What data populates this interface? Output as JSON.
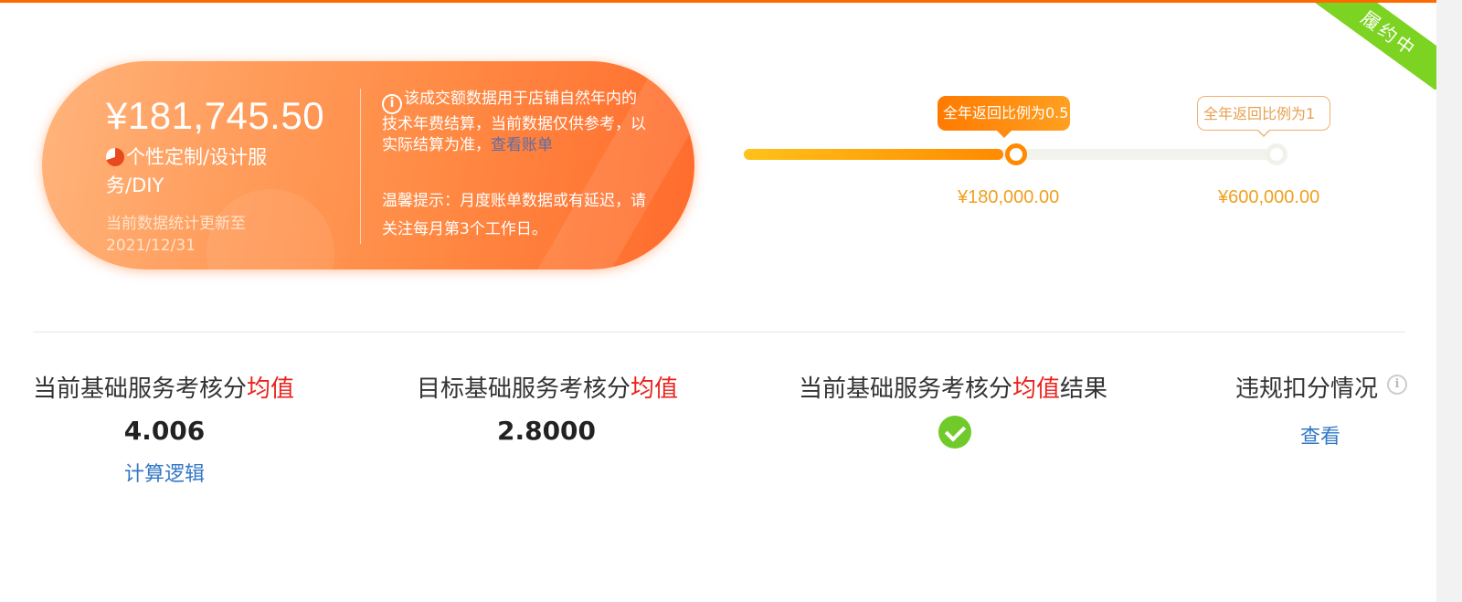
{
  "status_ribbon": {
    "label": "履约中",
    "color": "#7cd321"
  },
  "summary": {
    "amount": "¥181,745.50",
    "category": "个性定制/设计服务/DIY",
    "update_label": "当前数据统计更新至2021/12/31",
    "notice_text": "该成交额数据用于店铺自然年内的技术年费结算，当前数据仅供参考，以实际结算为准，",
    "view_bill_link": "查看账单",
    "warm_tip": "温馨提示：月度账单数据或有延迟，请关注每月第3个工作日。",
    "accent_color": "#ff7a30"
  },
  "progress": {
    "fill_fraction": 0.49,
    "tiers": [
      {
        "label": "全年返回比例为0.5",
        "amount": "¥180,000.00",
        "active": true
      },
      {
        "label": "全年返回比例为1",
        "amount": "¥600,000.00",
        "active": false
      }
    ]
  },
  "stats": [
    {
      "label_prefix": "当前基础服务考核分",
      "label_highlight": "均值",
      "label_suffix": "",
      "value": "4.006",
      "link": "计算逻辑"
    },
    {
      "label_prefix": "目标基础服务考核分",
      "label_highlight": "均值",
      "label_suffix": "",
      "value": "2.8000"
    },
    {
      "label_prefix": "当前基础服务考核分",
      "label_highlight": "均值",
      "label_suffix": "结果",
      "icon": "check-circle-icon"
    },
    {
      "label_prefix": "违规扣分情况",
      "icon": "info-icon",
      "link": "查看"
    }
  ],
  "colors": {
    "highlight": "#e8221c",
    "link": "#3478c6",
    "pass": "#6fca2a"
  }
}
